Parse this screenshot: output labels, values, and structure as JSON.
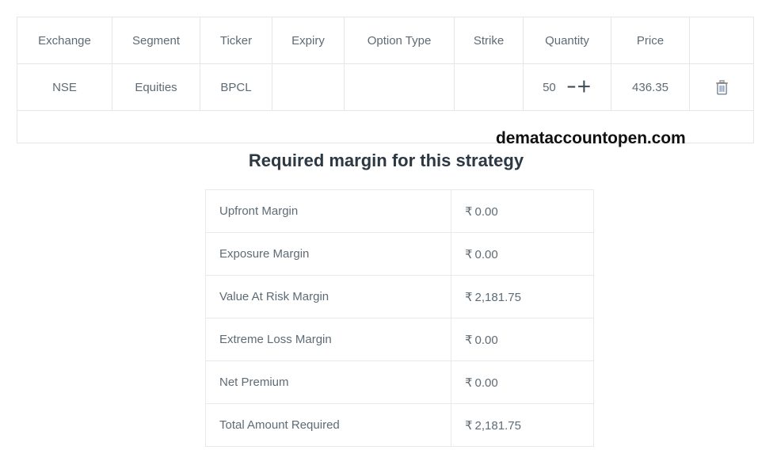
{
  "basket": {
    "columns": [
      "Exchange",
      "Segment",
      "Ticker",
      "Expiry",
      "Option Type",
      "Strike",
      "Quantity",
      "Price",
      ""
    ],
    "rows": [
      {
        "exchange": "NSE",
        "segment": "Equities",
        "ticker": "BPCL",
        "expiry": "",
        "option_type": "",
        "strike": "",
        "quantity": "50",
        "decrement_label": "−",
        "increment_label": "＋",
        "price": "436.35",
        "delete_icon": "trash-icon"
      }
    ],
    "empty_row_text": ""
  },
  "watermark": {
    "text": "demataccountopen.com"
  },
  "margin_section": {
    "heading": "Required margin for this strategy",
    "currency_symbol": "₹",
    "rows": [
      {
        "label": "Upfront Margin",
        "value": "0.00"
      },
      {
        "label": "Exposure Margin",
        "value": "0.00"
      },
      {
        "label": "Value At Risk Margin",
        "value": "2,181.75"
      },
      {
        "label": "Extreme Loss Margin",
        "value": "0.00"
      },
      {
        "label": "Net Premium",
        "value": "0.00"
      },
      {
        "label": "Total Amount Required",
        "value": "2,181.75"
      }
    ]
  },
  "colors": {
    "text": "#5e6b75",
    "heading": "#2c3843",
    "border": "#e6e6e6",
    "watermark": "#111111"
  }
}
